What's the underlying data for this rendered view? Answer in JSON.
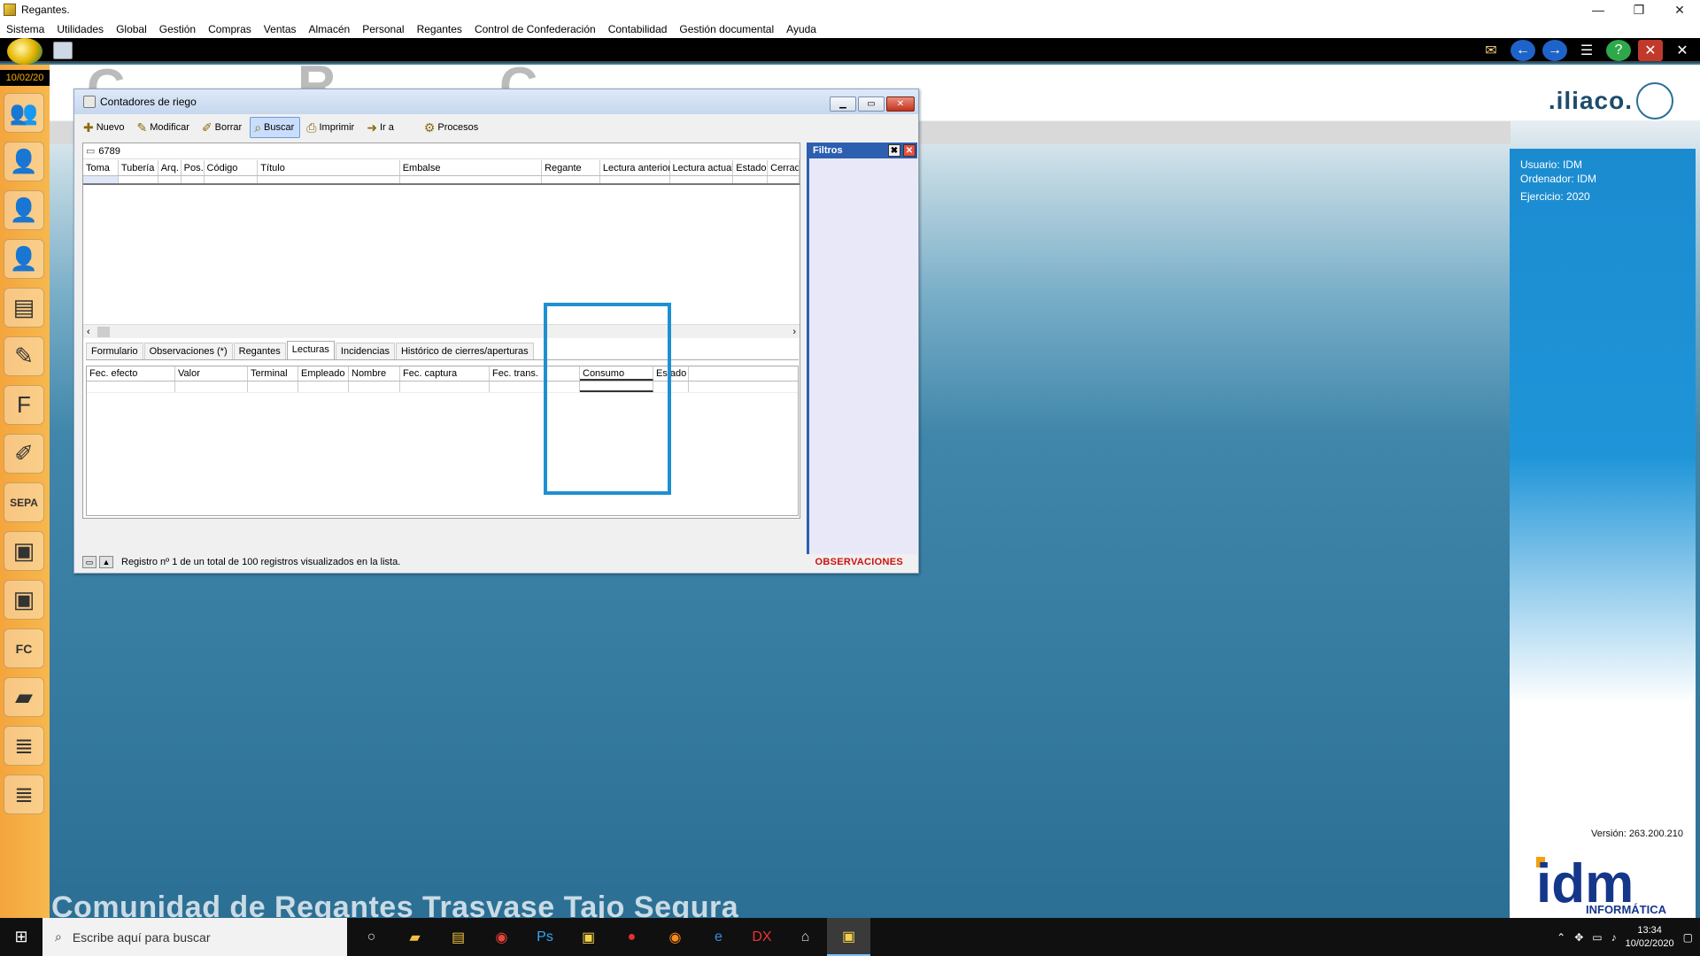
{
  "app": {
    "title": "Regantes.",
    "window_controls": [
      "—",
      "❐",
      "✕"
    ]
  },
  "menu": [
    "Sistema",
    "Utilidades",
    "Global",
    "Gestión",
    "Compras",
    "Ventas",
    "Almacén",
    "Personal",
    "Regantes",
    "Control de Confederación",
    "Contabilidad",
    "Gestión documental",
    "Ayuda"
  ],
  "leftrail": {
    "date": "10/02/20",
    "icons": [
      "users-icon",
      "user-a-icon",
      "user-icon",
      "user-icon",
      "database-icon",
      "notes-icon",
      "folder-f-icon",
      "edit-icon",
      "sepa-icon",
      "bag-icon",
      "bag-icon",
      "fc-icon",
      "folder-icon",
      "list-icon",
      "list-icon"
    ]
  },
  "topbar_icons": [
    "mail-icon",
    "back-icon",
    "forward-icon",
    "menu-icon",
    "help-icon",
    "close-icon",
    "exit-icon"
  ],
  "brand": {
    "logo_text": ".iliaco.",
    "bg_title": "Comunidad de Regantes Trasvase Tajo Segura"
  },
  "info": {
    "usuario": "Usuario: IDM",
    "ordenador": "Ordenador: IDM",
    "ejercicio": "Ejercicio: 2020",
    "version": "Versión: 263.200.210",
    "company_sub": "INFORMÁTICA"
  },
  "window": {
    "title": "Contadores de riego",
    "toolbar": [
      {
        "label": "Nuevo",
        "icon": "new-icon"
      },
      {
        "label": "Modificar",
        "icon": "edit-icon"
      },
      {
        "label": "Borrar",
        "icon": "delete-icon"
      },
      {
        "label": "Buscar",
        "icon": "search-icon"
      },
      {
        "label": "Imprimir",
        "icon": "print-icon"
      },
      {
        "label": "Ir a",
        "icon": "goto-icon"
      },
      {
        "label": "Procesos",
        "icon": "gear-icon"
      }
    ],
    "search_value": "6789",
    "columns": [
      "Toma",
      "Tubería",
      "Arq.",
      "Pos.",
      "Código",
      "Título",
      "Embalse",
      "Regante",
      "Lectura anterior",
      "Lectura actual",
      "Estado",
      "Cerrado"
    ],
    "tabs": [
      "Formulario",
      "Observaciones (*)",
      "Regantes",
      "Lecturas",
      "Incidencias",
      "Histórico de cierres/aperturas"
    ],
    "active_tab": "Lecturas",
    "sub_columns": [
      "Fec. efecto",
      "Valor",
      "Terminal",
      "Empleado",
      "Nombre",
      "Fec. captura",
      "Fec. trans.",
      "Consumo",
      "Estado"
    ],
    "filters_title": "Filtros",
    "status_text": "Registro nº 1 de un total de 100 registros visualizados en la lista.",
    "observaciones": "OBSERVACIONES"
  },
  "taskbar": {
    "search_placeholder": "Escribe aquí para buscar",
    "time": "13:34",
    "date": "10/02/2020"
  },
  "colors": {
    "accent": "#1f8fd0",
    "rail": "#f4a53c",
    "obs": "#cc1111"
  }
}
